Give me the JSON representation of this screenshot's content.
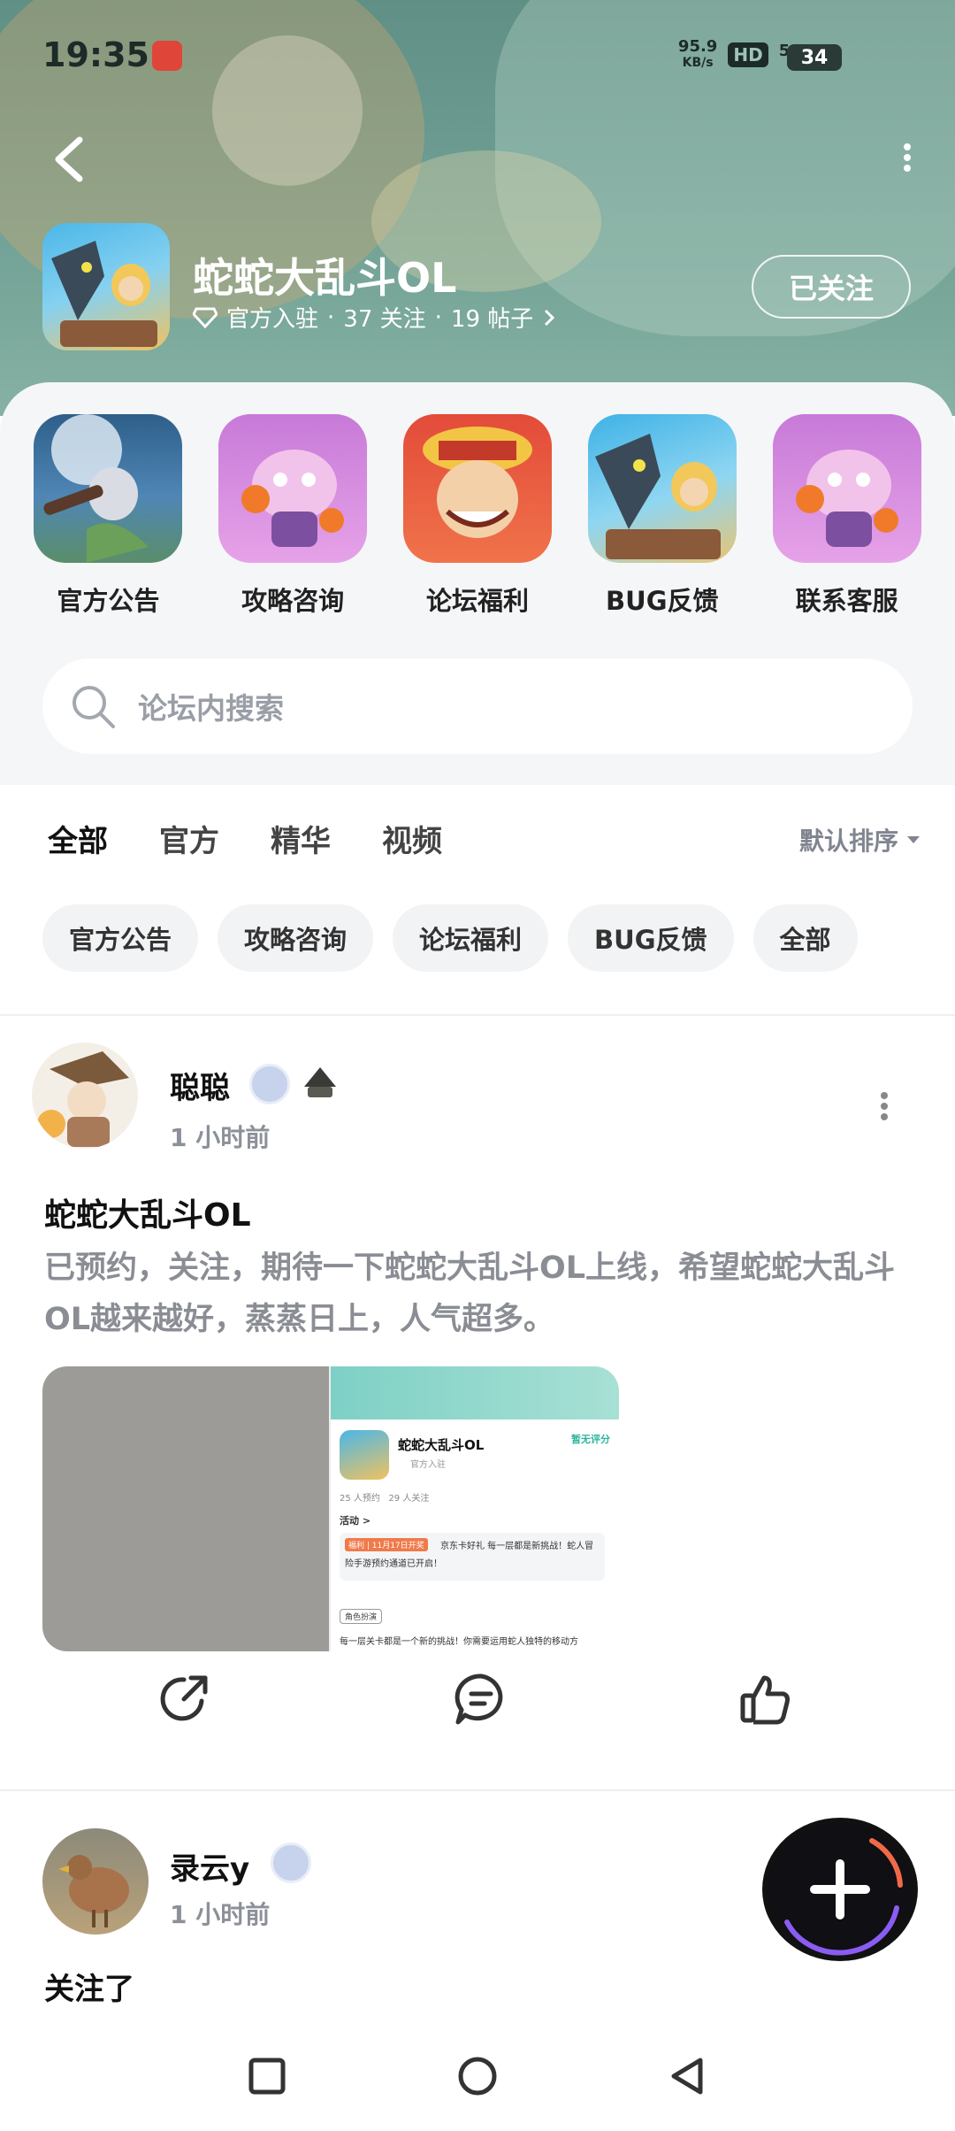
{
  "status_bar": {
    "time": "19:35",
    "net_speed_value": "95.9",
    "net_speed_unit": "KB/s",
    "hd_label": "HD",
    "network": "5G",
    "battery": "34"
  },
  "header": {
    "forum_title": "蛇蛇大乱斗OL",
    "meta_official": "官方入驻",
    "meta_follows": "37 关注",
    "meta_posts": "19 帖子",
    "meta_sep": "·",
    "follow_label": "已关注"
  },
  "entries": [
    {
      "label": "官方公告",
      "icon": "announcement-art-icon"
    },
    {
      "label": "攻略咨询",
      "icon": "guide-art-icon"
    },
    {
      "label": "论坛福利",
      "icon": "welfare-art-icon"
    },
    {
      "label": "BUG反馈",
      "icon": "bug-feedback-art-icon"
    },
    {
      "label": "联系客服",
      "icon": "customer-service-art-icon"
    }
  ],
  "search": {
    "placeholder": "论坛内搜索"
  },
  "tabs": [
    {
      "label": "全部",
      "active": true
    },
    {
      "label": "官方",
      "active": false
    },
    {
      "label": "精华",
      "active": false
    },
    {
      "label": "视频",
      "active": false
    }
  ],
  "sort_label": "默认排序",
  "chips": [
    "官方公告",
    "攻略咨询",
    "论坛福利",
    "BUG反馈",
    "全部"
  ],
  "posts": [
    {
      "username": "聪聪",
      "time": "1 小时前",
      "title": "蛇蛇大乱斗OL",
      "body": "已预约，关注，期待一下蛇蛇大乱斗OL上线，希望蛇蛇大乱斗OL越来越好，蒸蒸日上，人气超多。",
      "screenshot": {
        "app_name": "蛇蛇大乱斗OL",
        "rating": "暂无评分",
        "official": "官方入驻",
        "stats": "25 人预约   29 人关注",
        "activity": "活动 >",
        "tag": "福利 | 11月17日开奖",
        "announce": "京东卡好礼 每一层都是新挑战！蛇人冒险手游预约通道已开启！",
        "role_tag": "角色扮演",
        "desc": "每一层关卡都是一个新的挑战！你需要运用蛇人独特的移动方"
      }
    },
    {
      "username": "录云y",
      "time": "1 小时前",
      "title": "关注了"
    }
  ]
}
